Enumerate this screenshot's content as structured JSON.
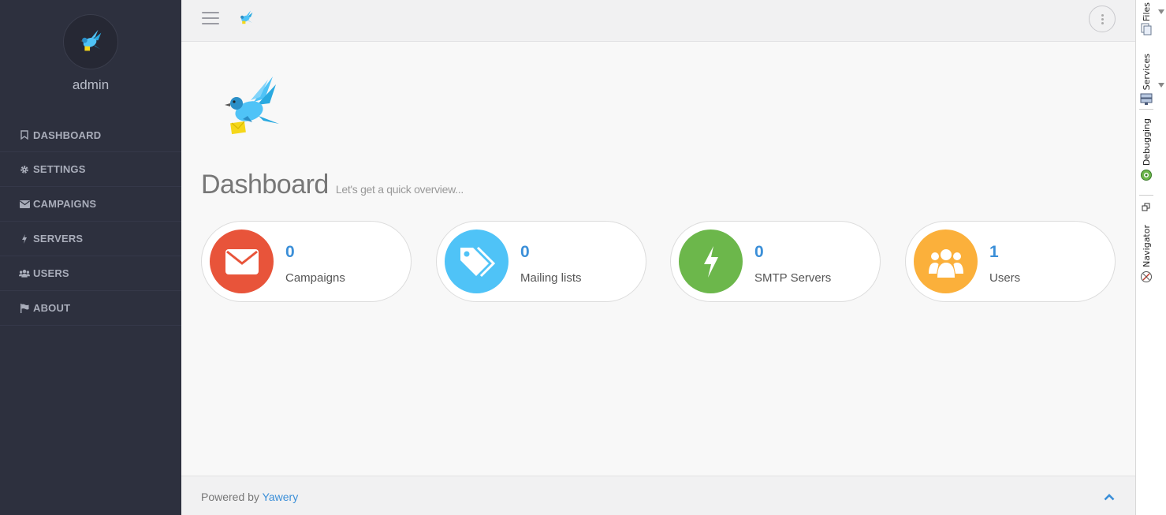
{
  "user": {
    "name": "admin"
  },
  "sidebar": {
    "items": [
      {
        "label": "DASHBOARD",
        "icon": "bookmark-icon"
      },
      {
        "label": "SETTINGS",
        "icon": "gear-icon"
      },
      {
        "label": "CAMPAIGNS",
        "icon": "envelope-icon"
      },
      {
        "label": "SERVERS",
        "icon": "bolt-icon"
      },
      {
        "label": "USERS",
        "icon": "users-icon"
      },
      {
        "label": "ABOUT",
        "icon": "flag-icon"
      }
    ]
  },
  "page": {
    "title": "Dashboard",
    "subtitle": "Let's get a quick overview..."
  },
  "stats": [
    {
      "count": "0",
      "label": "Campaigns",
      "color": "#e8543a",
      "icon": "envelope-icon"
    },
    {
      "count": "0",
      "label": "Mailing lists",
      "color": "#4fc3f7",
      "icon": "tags-icon"
    },
    {
      "count": "0",
      "label": "SMTP Servers",
      "color": "#6cb74b",
      "icon": "bolt-icon"
    },
    {
      "count": "1",
      "label": "Users",
      "color": "#fbb03b",
      "icon": "users-icon"
    }
  ],
  "footer": {
    "powered_by": "Powered by",
    "brand": "Yawery"
  },
  "ide_tabs": [
    "Files",
    "Services",
    "Debugging",
    "Navigator"
  ],
  "colors": {
    "sidebar_bg": "#2d303e",
    "accent": "#3b8fd8"
  }
}
